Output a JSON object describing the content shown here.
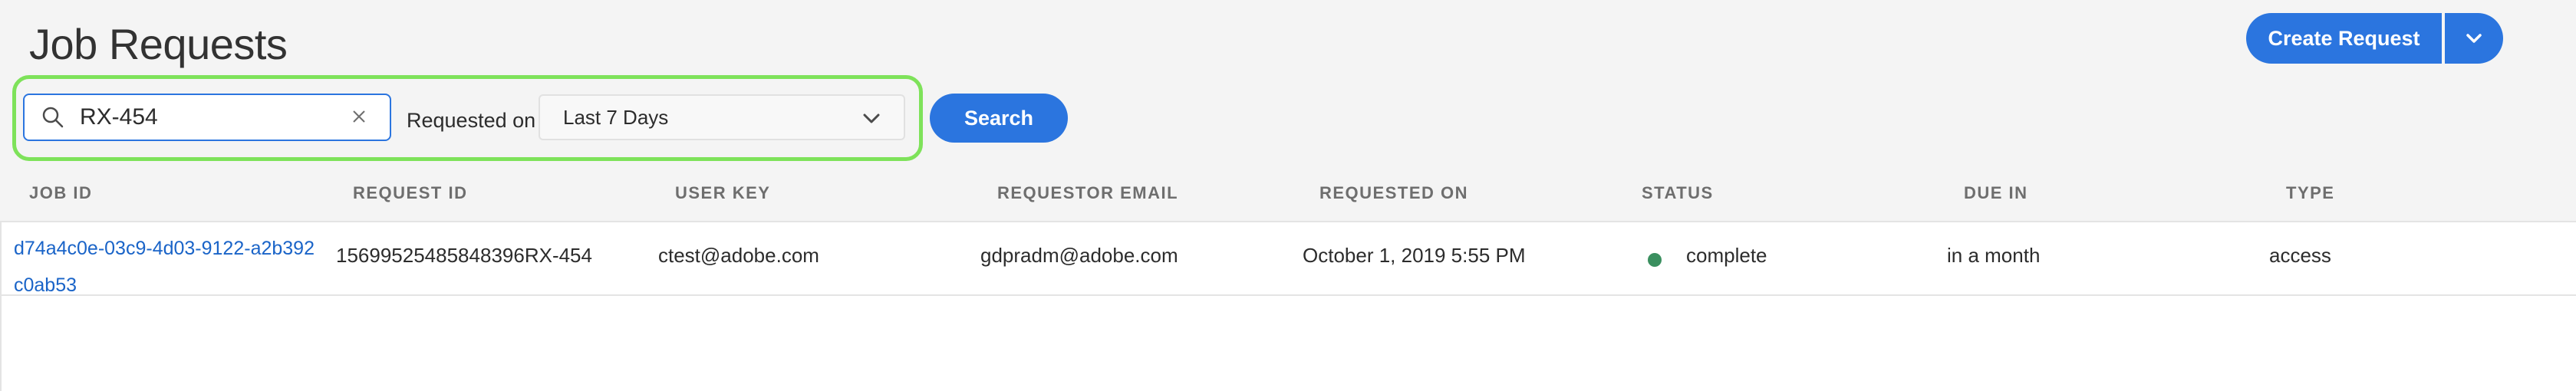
{
  "page": {
    "title": "Job Requests"
  },
  "actions": {
    "create_request_label": "Create Request"
  },
  "filters": {
    "search_value": "RX-454",
    "requested_on_label": "Requested on",
    "requested_on_value": "Last 7 Days",
    "search_button_label": "Search"
  },
  "table": {
    "columns": [
      "JOB ID",
      "REQUEST ID",
      "USER KEY",
      "REQUESTOR EMAIL",
      "REQUESTED ON",
      "STATUS",
      "DUE IN",
      "TYPE"
    ],
    "rows": [
      {
        "job_id_line1": "d74a4c0e-03c9-4d03-9122-a2b392",
        "job_id_line2": "c0ab53",
        "request_id": "15699525485848396RX-454",
        "user_key": "ctest@adobe.com",
        "requestor_email": "gdpradm@adobe.com",
        "requested_on": "October 1, 2019 5:55 PM",
        "status": "complete",
        "status_color": "#3a8f5f",
        "due_in": "in a month",
        "type": "access"
      }
    ]
  },
  "colors": {
    "accent": "#2b75df",
    "focus_highlight": "#7ee25a",
    "link": "#1a64c8"
  },
  "icons": {
    "search": "search-icon",
    "clear": "close-icon",
    "dropdown": "chevron-down-icon",
    "create_menu": "chevron-down-icon"
  }
}
